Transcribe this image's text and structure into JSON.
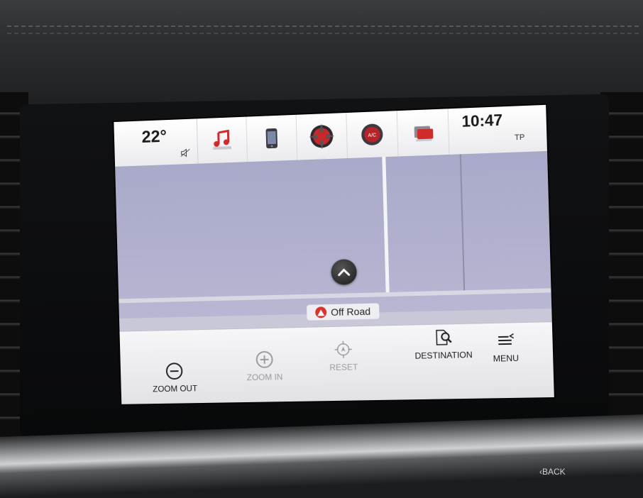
{
  "status_bar": {
    "temperature": "22°",
    "time": "10:47",
    "tp_indicator": "TP"
  },
  "apps": [
    {
      "name": "audio",
      "icon": "music-note-icon"
    },
    {
      "name": "phone",
      "icon": "phone-icon"
    },
    {
      "name": "navigation",
      "icon": "compass-icon",
      "active": true
    },
    {
      "name": "climate",
      "icon": "ac-icon",
      "label": "A/C"
    },
    {
      "name": "messages",
      "icon": "message-icon"
    }
  ],
  "map": {
    "road_status": "Off Road"
  },
  "softkeys": {
    "zoom_out": "ZOOM OUT",
    "zoom_in": "ZOOM IN",
    "reset": "RESET",
    "destination": "DESTINATION",
    "menu": "MENU"
  },
  "hardware": {
    "back_label": "‹BACK"
  },
  "colors": {
    "map_bg": "#b0b0cc",
    "alert_red": "#d8342c",
    "bar_bg": "#ececf0"
  }
}
